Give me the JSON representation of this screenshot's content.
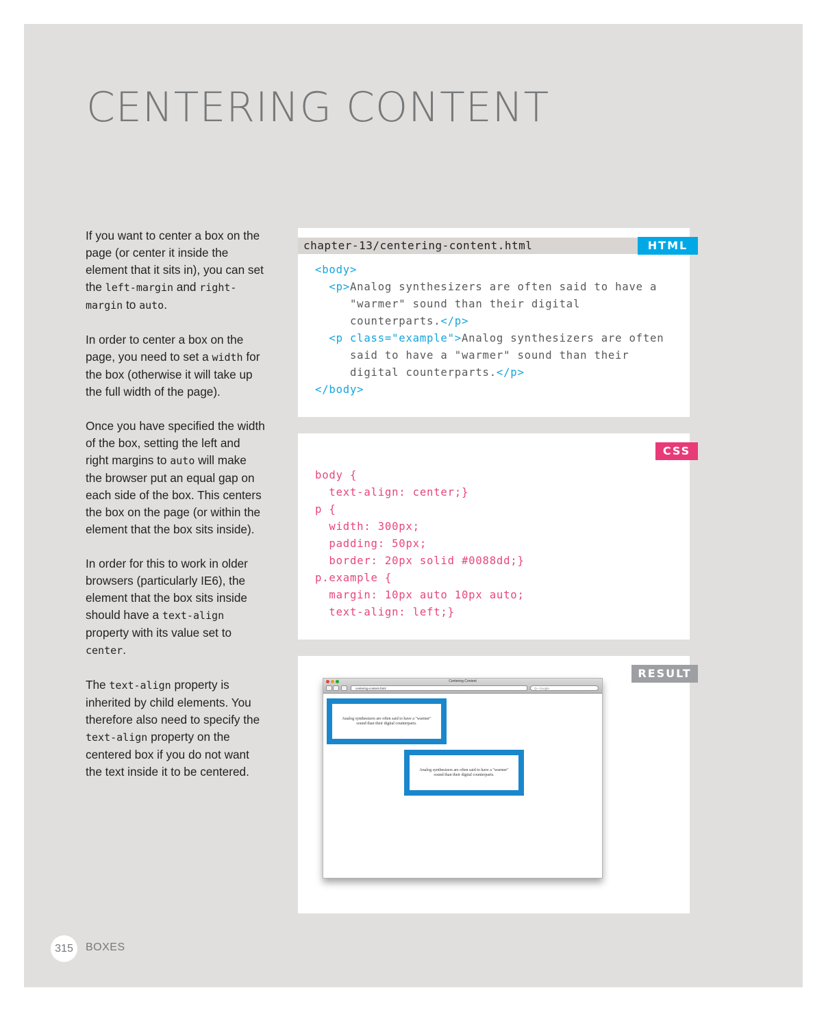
{
  "page": {
    "title": "CENTERING CONTENT",
    "page_number": "315",
    "section": "BOXES"
  },
  "body": {
    "p1": {
      "t1": "If you want to center a box on the page (or center it inside the element that it sits in), you can set the ",
      "c1": "left-margin",
      "t2": " and ",
      "c2": "right-margin",
      "t3": " to ",
      "c3": "auto",
      "t4": "."
    },
    "p2": {
      "t1": "In order to center a box on the page, you need to set a ",
      "c1": "width",
      "t2": " for the box (otherwise it will take up the full width of the page)."
    },
    "p3": {
      "t1": "Once you have specified the width of the box, setting the left and right margins to ",
      "c1": "auto",
      "t2": " will make the browser put an equal gap on each side of the box. This centers the box on the page (or within the element that the box sits inside)."
    },
    "p4": {
      "t1": "In order for this to work in older browsers (particularly IE6), the element that the box sits inside should have a ",
      "c1": "text-align",
      "t2": " property with its value set to ",
      "c2": "center",
      "t3": "."
    },
    "p5": {
      "t1": "The ",
      "c1": "text-align",
      "t2": " property is inherited by child elements. You therefore also need to specify the ",
      "c2": "text-align",
      "t3": " property on the centered box if you do not want the text inside it to be centered."
    }
  },
  "html_panel": {
    "filename": "chapter-13/centering-content.html",
    "tag": "HTML",
    "code": {
      "body_open": "<body>",
      "p_open": "<p>",
      "p1_line1": "Analog synthesizers are often said to have a",
      "p1_line2": "\"warmer\" sound than their digital",
      "p1_line3": "counterparts.",
      "p_close": "</p>",
      "p_class_open": "<p class=\"example\">",
      "p2_line1": "Analog synthesizers are often",
      "p2_line2": "said to have a \"warmer\" sound than their",
      "p2_line3": "digital counterparts.",
      "body_close": "</body>"
    }
  },
  "css_panel": {
    "tag": "CSS",
    "lines": [
      "body {",
      "  text-align: center;}",
      "p {",
      "  width: 300px;",
      "  padding: 50px;",
      "  border: 20px solid #0088dd;}",
      "p.example {",
      "  margin: 10px auto 10px auto;",
      "  text-align: left;}"
    ]
  },
  "result_panel": {
    "tag": "RESULT",
    "browser_title": "Centering Content",
    "url": "centering-content.html",
    "search_placeholder": "Q~ Google",
    "box1_text": "Analog synthesizers are often said to have a \"warmer\" sound than their digital counterparts.",
    "box2_text": "Analog synthesizers are often said to have a \"warmer\" sound than their digital counterparts."
  },
  "colors": {
    "html_tag": "#00a9e6",
    "css_tag": "#e83a77",
    "result_tag": "#9d9fa2",
    "page_background": "#e1dfdd",
    "demo_border": "#1a87cc"
  }
}
